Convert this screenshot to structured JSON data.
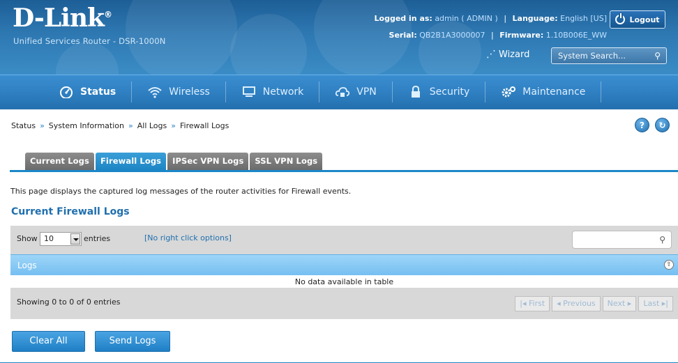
{
  "header": {
    "logo": "D-Link",
    "logo_mark": "®",
    "product": "Unified Services Router - DSR-1000N",
    "logged_in_label": "Logged in as:",
    "logged_in_value": "admin ( ADMIN )",
    "language_label": "Language:",
    "language_value": "English [US]",
    "serial_label": "Serial:",
    "serial_value": "QB2B1A3000007",
    "firmware_label": "Firmware:",
    "firmware_value": "1.10B006E_WW",
    "logout_label": "Logout",
    "wizard_label": "Wizard",
    "search_placeholder": "System Search..."
  },
  "nav": {
    "items": [
      {
        "label": "Status",
        "icon": "speedometer-icon",
        "active": true
      },
      {
        "label": "Wireless",
        "icon": "wifi-icon",
        "active": false
      },
      {
        "label": "Network",
        "icon": "monitor-icon",
        "active": false
      },
      {
        "label": "VPN",
        "icon": "cloud-lock-icon",
        "active": false
      },
      {
        "label": "Security",
        "icon": "padlock-icon",
        "active": false
      },
      {
        "label": "Maintenance",
        "icon": "gears-icon",
        "active": false
      }
    ]
  },
  "breadcrumb": [
    "Status",
    "System Information",
    "All Logs",
    "Firewall Logs"
  ],
  "breadcrumb_sep": "»",
  "help_icons": {
    "help": "?",
    "refresh": "↻"
  },
  "tabs": [
    {
      "label": "Current Logs",
      "active": false
    },
    {
      "label": "Firewall Logs",
      "active": true
    },
    {
      "label": "IPSec VPN Logs",
      "active": false
    },
    {
      "label": "SSL VPN Logs",
      "active": false
    }
  ],
  "description": "This page displays the captured log messages of the router activities for Firewall events.",
  "section_title": "Current Firewall Logs",
  "table": {
    "show_label": "Show",
    "entries_value": "10",
    "entries_label": "entries",
    "right_click": "[No right click options]",
    "header": "Logs",
    "empty_message": "No data available in table",
    "showing": "Showing 0 to 0 of 0 entries",
    "pager": {
      "first": "First",
      "previous": "Previous",
      "next": "Next",
      "last": "Last"
    }
  },
  "buttons": {
    "clear_all": "Clear All",
    "send_logs": "Send Logs"
  },
  "colors": {
    "brand_blue": "#2e78b2",
    "accent_blue": "#1b87c8",
    "link_blue": "#1f6fae"
  }
}
